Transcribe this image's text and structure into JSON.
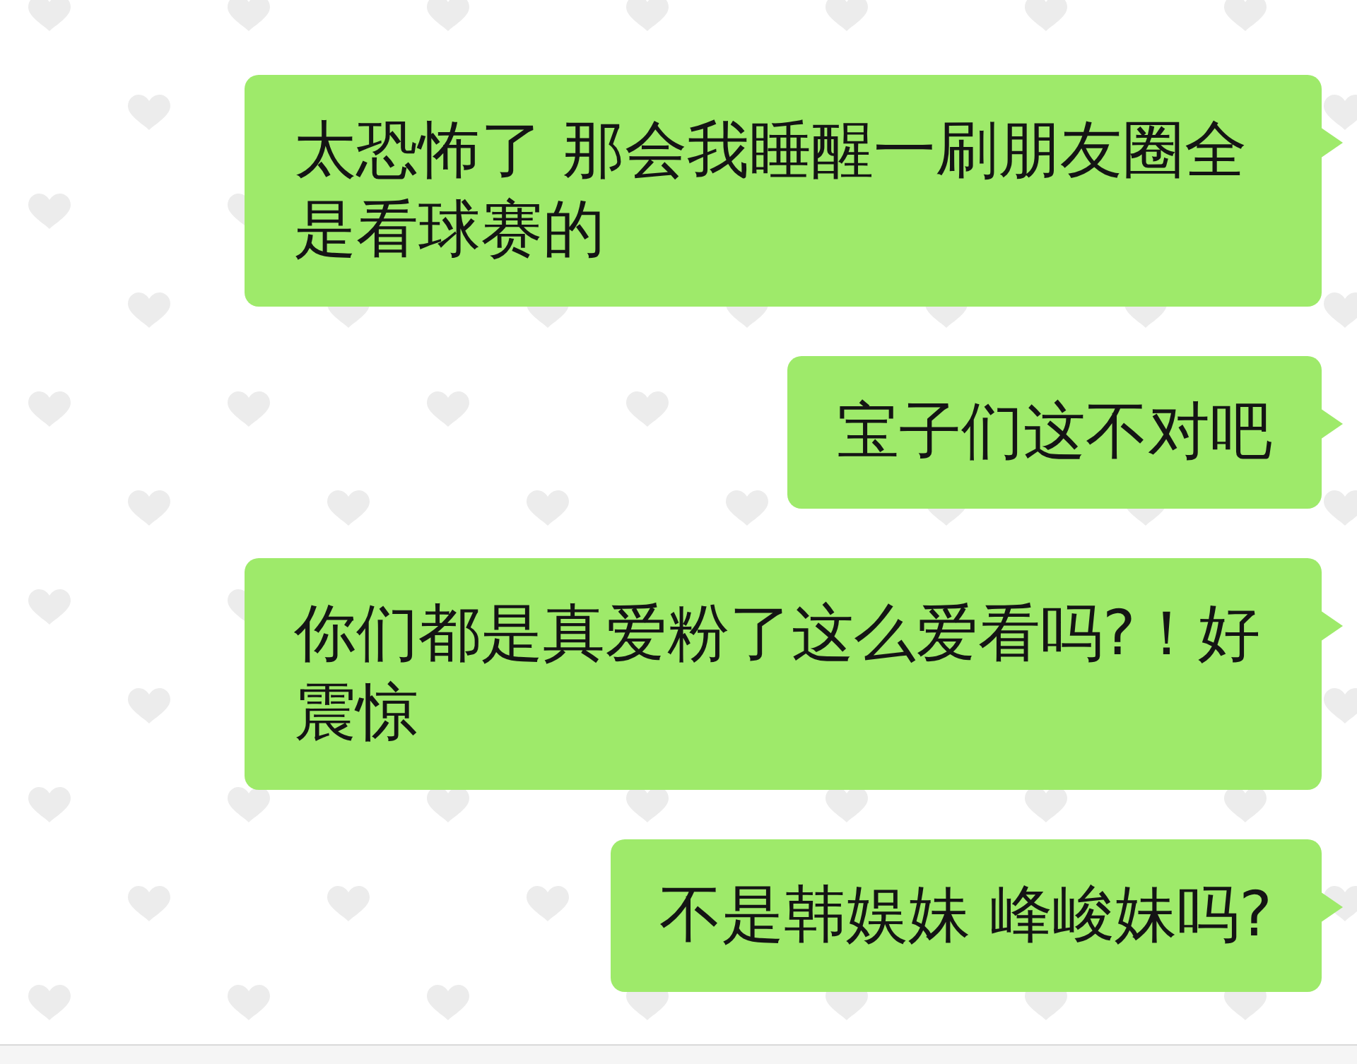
{
  "messages": [
    {
      "text": "太恐怖了 那会我睡醒一刷朋友圈全是看球赛的"
    },
    {
      "text": "宝子们这不对吧"
    },
    {
      "text": "你们都是真爱粉了这么爱看吗?！好震惊"
    },
    {
      "text": "不是韩娱妹 峰峻妹吗?"
    }
  ]
}
